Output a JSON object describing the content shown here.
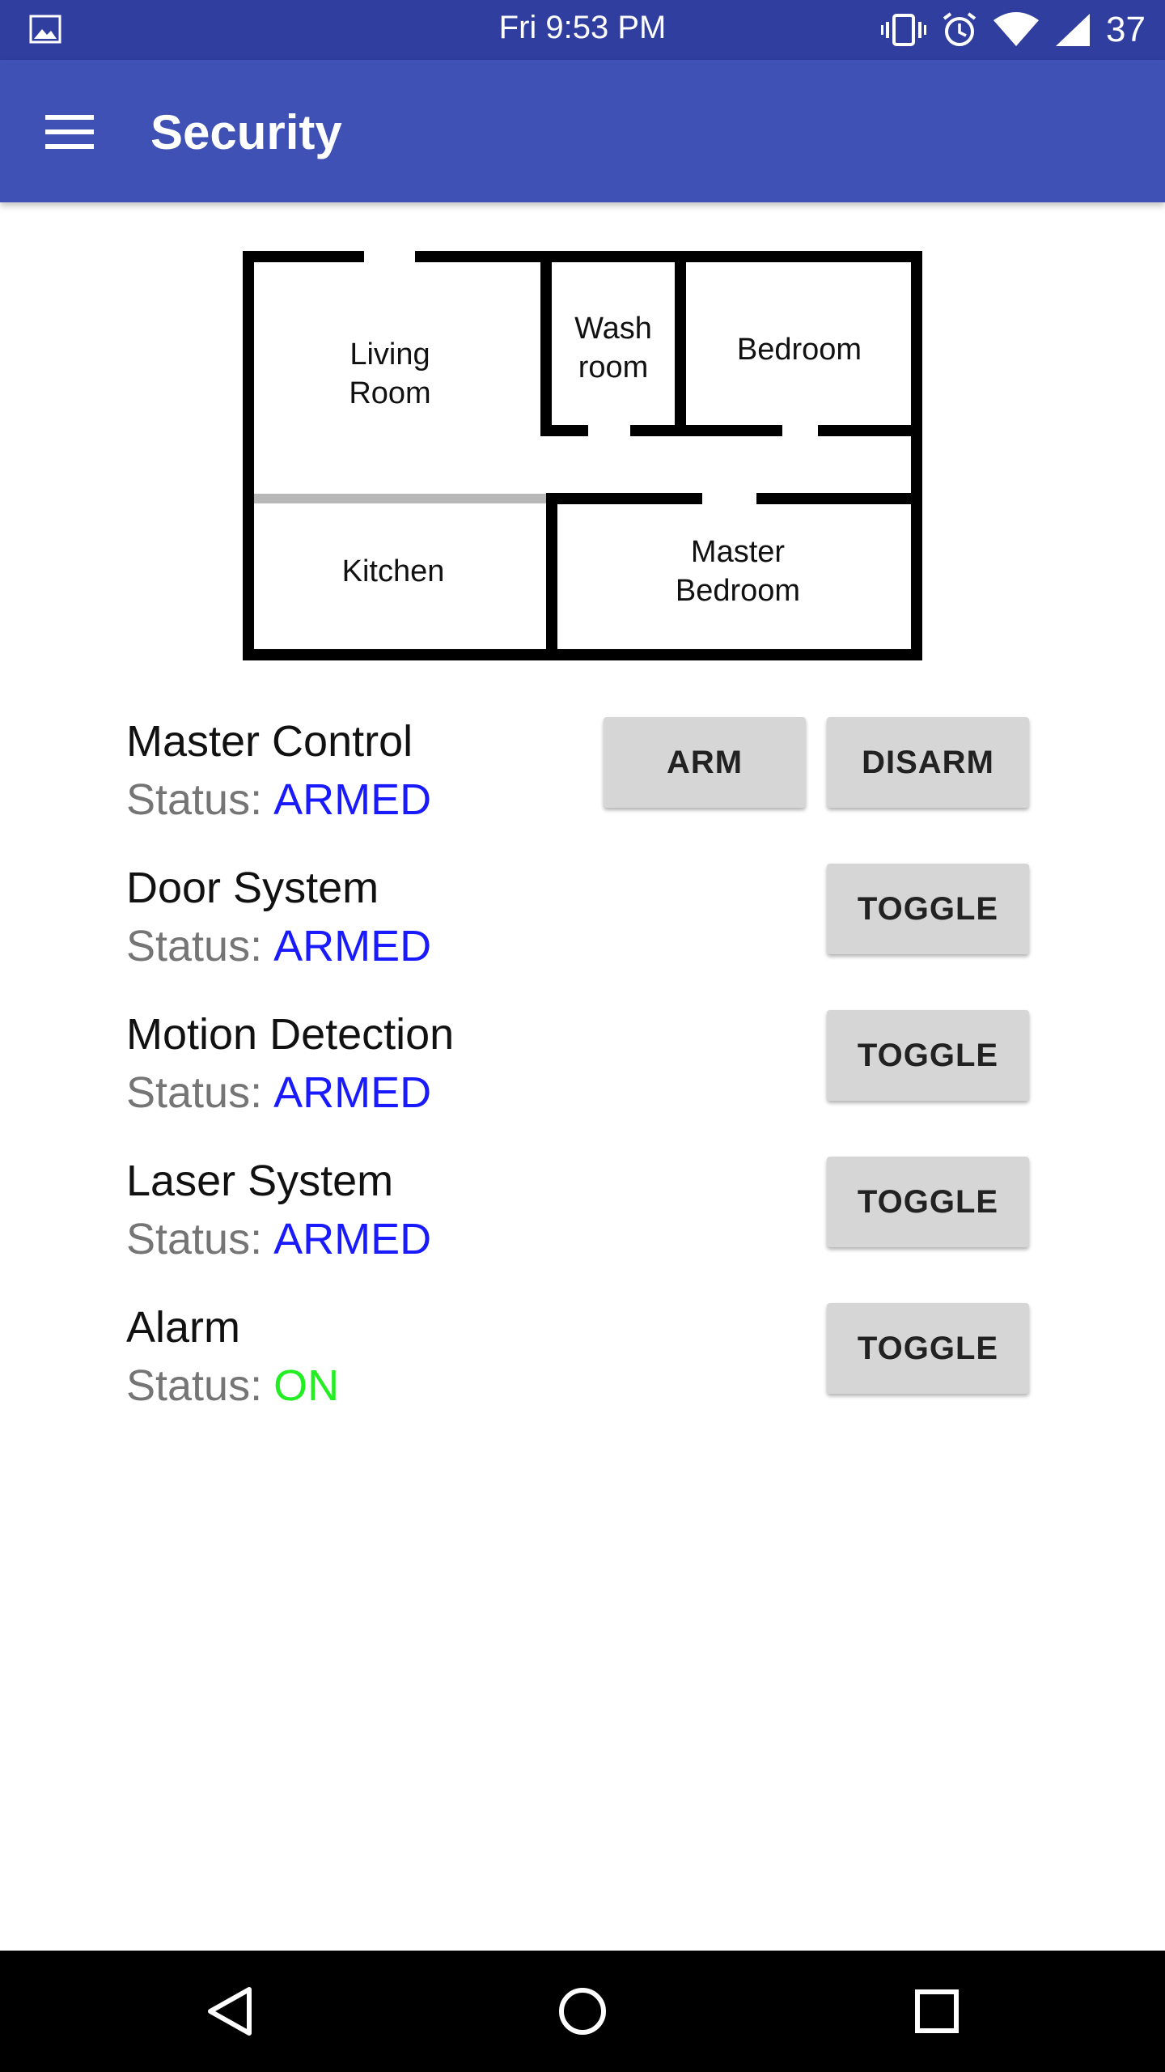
{
  "status_bar": {
    "time": "Fri 9:53 PM",
    "battery": "37",
    "icons": [
      "image-icon",
      "vibrate-icon",
      "alarm-clock-icon",
      "wifi-icon",
      "signal-icon"
    ]
  },
  "app_bar": {
    "title": "Security",
    "menu_icon": "hamburger-menu-icon"
  },
  "floor_plan": {
    "rooms": {
      "living_room_line1": "Living",
      "living_room_line2": "Room",
      "washroom_line1": "Wash",
      "washroom_line2": "room",
      "bedroom": "Bedroom",
      "kitchen": "Kitchen",
      "master_bedroom_line1": "Master",
      "master_bedroom_line2": "Bedroom"
    }
  },
  "controls": {
    "status_prefix": "Status:",
    "master": {
      "title": "Master Control",
      "status": "ARMED",
      "arm_label": "ARM",
      "disarm_label": "DISARM"
    },
    "door": {
      "title": "Door System",
      "status": "ARMED",
      "button_label": "TOGGLE"
    },
    "motion": {
      "title": "Motion Detection",
      "status": "ARMED",
      "button_label": "TOGGLE"
    },
    "laser": {
      "title": "Laser System",
      "status": "ARMED",
      "button_label": "TOGGLE"
    },
    "alarm": {
      "title": "Alarm",
      "status": "ON",
      "button_label": "TOGGLE"
    }
  },
  "colors": {
    "status_bar": "#303f9f",
    "app_bar": "#3f51b5",
    "armed": "#1a1aff",
    "on": "#22ee22",
    "button": "#d6d6d6"
  },
  "nav_bar": {
    "icons": [
      "back-icon",
      "home-icon",
      "recents-icon"
    ]
  }
}
